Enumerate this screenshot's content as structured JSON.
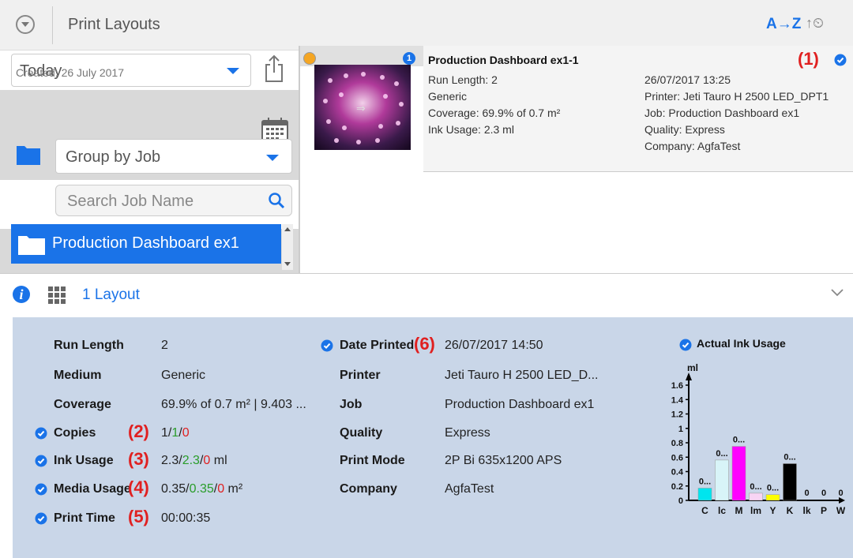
{
  "header": {
    "title": "Print Layouts",
    "sort_az": "A→Z",
    "sort_time": "↑⏲"
  },
  "filter": {
    "period": "Today",
    "created": "Created: 26 July 2017",
    "group_by": "Group by Job",
    "search_placeholder": "Search Job Name",
    "selected_job": "Production Dashboard ex1"
  },
  "card": {
    "index": "1",
    "title": "Production Dashboard ex1-1",
    "left_lines": [
      "Run Length: 2",
      "Generic",
      "Coverage: 69.9% of 0.7 m²",
      "Ink Usage: 2.3 ml"
    ],
    "right_lines": [
      "26/07/2017 13:25",
      "Printer: Jeti Tauro H 2500 LED_DPT1",
      "Job: Production Dashboard ex1",
      "Quality: Express",
      "Company: AgfaTest"
    ],
    "flag": "(1)"
  },
  "summary": {
    "layout_count": "1 Layout"
  },
  "details": {
    "run_length_label": "Run Length",
    "run_length": "2",
    "medium_label": "Medium",
    "medium": "Generic",
    "coverage_label": "Coverage",
    "coverage": "69.9% of 0.7  m² | 9.403  ...",
    "copies_label": "Copies",
    "copies_flag": "(2)",
    "copies_a": "1/",
    "copies_b": "1",
    "copies_sep": "/",
    "copies_c": "0",
    "ink_label": "Ink Usage",
    "ink_flag": "(3)",
    "ink_a": "2.3/",
    "ink_b": "2.3",
    "ink_sep": "/",
    "ink_c": "0",
    "ink_unit": " ml",
    "media_label": "Media Usage",
    "media_flag": "(4)",
    "media_a": "0.35/",
    "media_b": "0.35",
    "media_sep": "/",
    "media_c": "0",
    "media_unit": " m²",
    "time_label": "Print Time",
    "time_flag": "(5)",
    "time": "00:00:35",
    "date_label": "Date Printed",
    "date_flag": "(6)",
    "date": "26/07/2017 14:50",
    "printer_label": "Printer",
    "printer": "Jeti Tauro H 2500 LED_D...",
    "job_label": "Job",
    "job": "Production Dashboard ex1",
    "quality_label": "Quality",
    "quality": "Express",
    "mode_label": "Print Mode",
    "mode": "2P Bi 635x1200 APS",
    "company_label": "Company",
    "company": "AgfaTest"
  },
  "chart_data": {
    "type": "bar",
    "title": "Actual Ink Usage",
    "ylabel": "ml",
    "ylim": [
      0,
      1.6
    ],
    "yticks": [
      "0",
      "0.2",
      "0.4",
      "0.6",
      "0.8",
      "1",
      "1.2",
      "1.4",
      "1.6"
    ],
    "categories": [
      "C",
      "lc",
      "M",
      "lm",
      "Y",
      "K",
      "lk",
      "P",
      "W"
    ],
    "values": [
      0.17,
      0.56,
      0.75,
      0.1,
      0.08,
      0.51,
      0,
      0,
      0
    ],
    "data_labels": [
      "0...",
      "0...",
      "0...",
      "0...",
      "0...",
      "0...",
      "0",
      "0",
      "0"
    ],
    "colors": [
      "#00e5ee",
      "#d8f4f8",
      "#ff00ff",
      "#f8d4f4",
      "#ffff00",
      "#000000",
      "#cccccc",
      "#cccccc",
      "#cccccc"
    ]
  }
}
